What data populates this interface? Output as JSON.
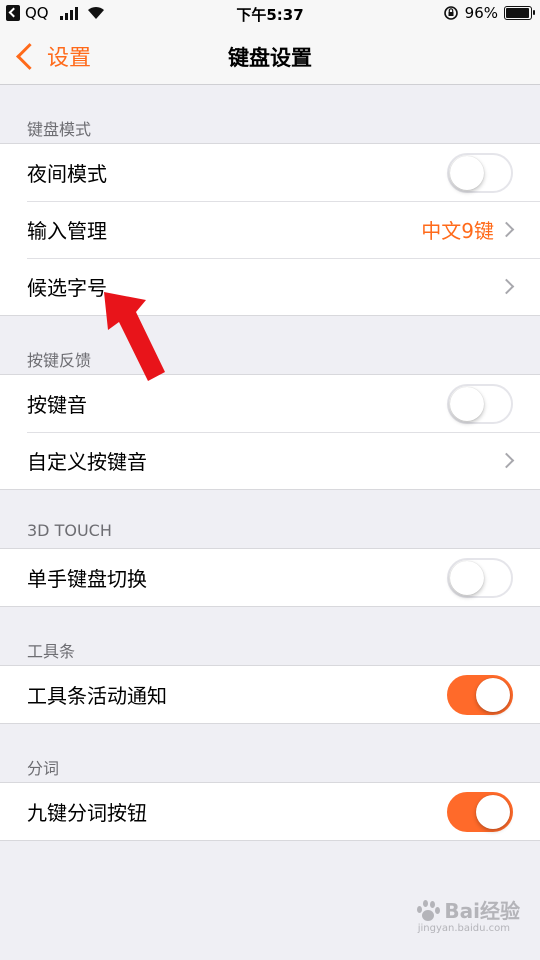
{
  "status_bar": {
    "carrier": "QQ",
    "time": "下午5:37",
    "battery": "96%",
    "battery_level": 0.96
  },
  "nav": {
    "back_label": "设置",
    "title": "键盘设置"
  },
  "sections": [
    {
      "header": "键盘模式",
      "rows": [
        {
          "label": "夜间模式",
          "control": "toggle",
          "on": false
        },
        {
          "label": "输入管理",
          "control": "disclosure",
          "value": "中文9键"
        },
        {
          "label": "候选字号",
          "control": "disclosure",
          "value": ""
        }
      ]
    },
    {
      "header": "按键反馈",
      "rows": [
        {
          "label": "按键音",
          "control": "toggle",
          "on": false
        },
        {
          "label": "自定义按键音",
          "control": "disclosure",
          "value": ""
        }
      ]
    },
    {
      "header": "3D TOUCH",
      "rows": [
        {
          "label": "单手键盘切换",
          "control": "toggle",
          "on": false
        }
      ]
    },
    {
      "header": "工具条",
      "rows": [
        {
          "label": "工具条活动通知",
          "control": "toggle",
          "on": true
        }
      ]
    },
    {
      "header": "分词",
      "rows": [
        {
          "label": "九键分词按钮",
          "control": "toggle",
          "on": true
        }
      ]
    }
  ],
  "watermark": {
    "text": "Bai经验",
    "subtext": "jingyan.baidu.com"
  },
  "colors": {
    "accent": "#ff6a1a",
    "toggle_on": "#ff6a2a",
    "annotation_arrow": "#e8141a",
    "background": "#efeff4"
  },
  "icons": {
    "back": "chevron-left-icon",
    "disclosure": "chevron-right-icon",
    "annotation": "red-arrow-icon"
  }
}
